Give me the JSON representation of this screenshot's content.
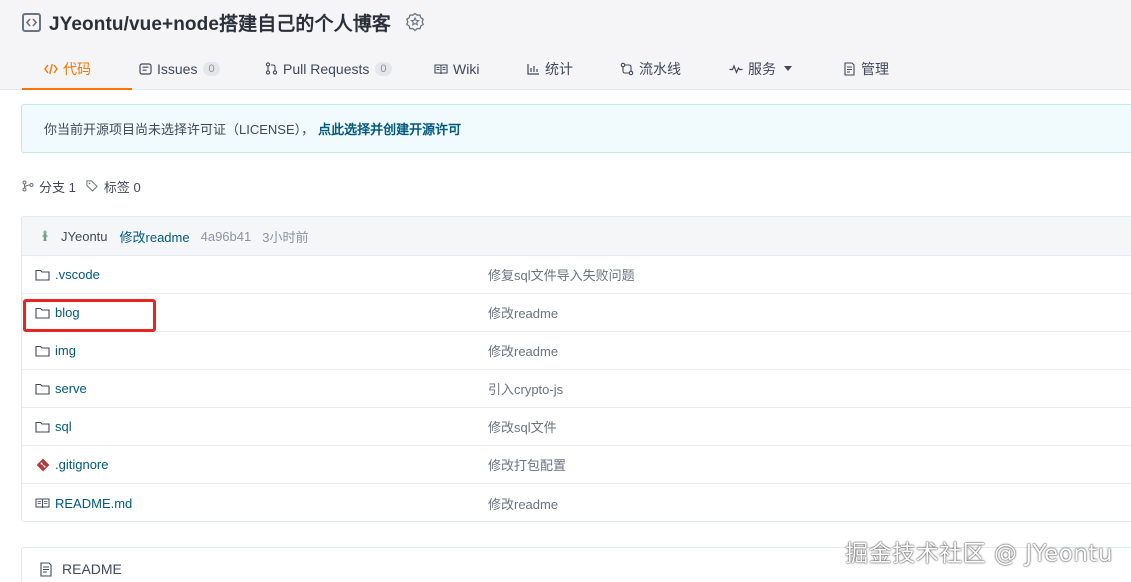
{
  "repo": {
    "title": "JYeontu/vue+node搭建自己的个人博客"
  },
  "tabs": [
    {
      "label": "代码",
      "icon": "code-icon",
      "active": true
    },
    {
      "label": "Issues",
      "icon": "issues-icon",
      "count": "0"
    },
    {
      "label": "Pull Requests",
      "icon": "pull-request-icon",
      "count": "0"
    },
    {
      "label": "Wiki",
      "icon": "book-icon"
    },
    {
      "label": "统计",
      "icon": "bar-chart-icon"
    },
    {
      "label": "流水线",
      "icon": "pipeline-icon"
    },
    {
      "label": "服务",
      "icon": "pulse-icon"
    },
    {
      "label": "管理",
      "icon": "settings-doc-icon"
    }
  ],
  "license": {
    "text": "你当前开源项目尚未选择许可证（LICENSE），",
    "link": "点此选择并创建开源许可"
  },
  "meta": {
    "branches": "分支 1",
    "tags": "标签 0"
  },
  "commit": {
    "author": "JYeontu",
    "message": "修改readme",
    "sha": "4a96b41",
    "time": "3小时前"
  },
  "files": [
    {
      "name": ".vscode",
      "type": "folder",
      "message": "修复sql文件导入失败问题"
    },
    {
      "name": "blog",
      "type": "folder",
      "message": "修改readme"
    },
    {
      "name": "img",
      "type": "folder",
      "message": "修改readme"
    },
    {
      "name": "serve",
      "type": "folder",
      "message": "引入crypto-js"
    },
    {
      "name": "sql",
      "type": "folder",
      "message": "修改sql文件"
    },
    {
      "name": ".gitignore",
      "type": "git",
      "message": "修改打包配置"
    },
    {
      "name": "README.md",
      "type": "readme",
      "message": "修改readme"
    }
  ],
  "readme": {
    "title": "README"
  },
  "watermark": "掘金技术社区 @ JYeontu",
  "colors": {
    "accent": "#fe7300",
    "link": "#005980",
    "highlight": "#e8261f"
  }
}
